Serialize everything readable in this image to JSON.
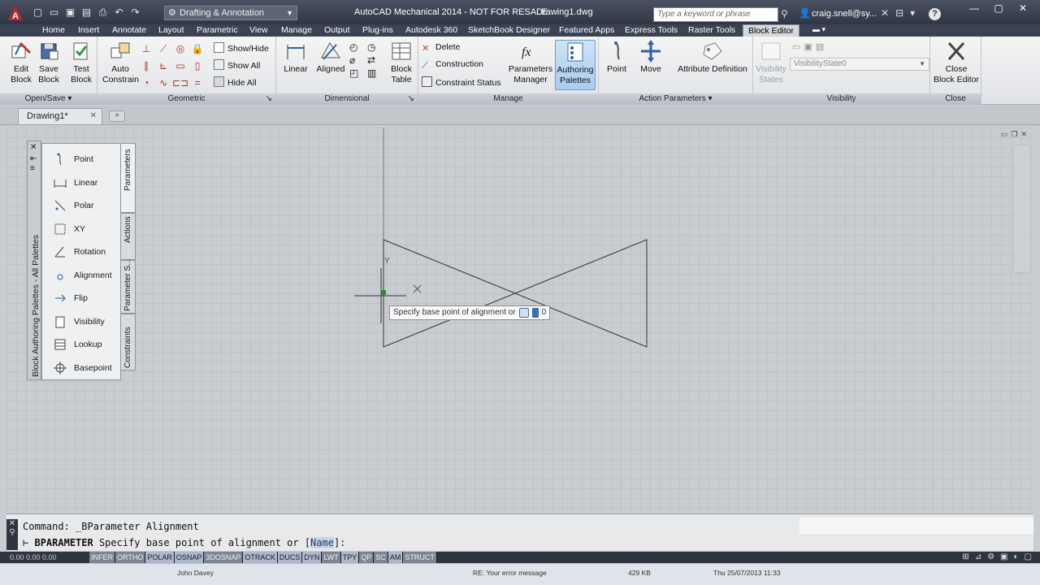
{
  "titlebar": {
    "workspace": "Drafting & Annotation",
    "app_title": "AutoCAD Mechanical 2014 - NOT FOR RESALE",
    "file_name": "Drawing1.dwg",
    "search_placeholder": "Type a keyword or phrase",
    "user": "craig.snell@sy..."
  },
  "tabs": [
    "Home",
    "Insert",
    "Annotate",
    "Layout",
    "Parametric",
    "View",
    "Manage",
    "Output",
    "Plug-ins",
    "Autodesk 360",
    "SketchBook Designer",
    "Featured Apps",
    "Express Tools",
    "Raster Tools",
    "Block Editor"
  ],
  "active_tab": "Block Editor",
  "ribbon": {
    "open_save": {
      "title": "Open/Save",
      "edit_block": "Edit\nBlock",
      "save_block": "Save\nBlock"
    },
    "geometric": {
      "title": "Geometric",
      "test_block": "Test\nBlock",
      "auto_constrain": "Auto\nConstrain",
      "show_hide": "Show/Hide",
      "show_all": "Show All",
      "hide_all": "Hide All"
    },
    "dimensional": {
      "title": "Dimensional",
      "linear": "Linear",
      "aligned": "Aligned",
      "block_table": "Block\nTable"
    },
    "manage": {
      "title": "Manage",
      "delete": "Delete",
      "construction": "Construction",
      "constraint_status": "Constraint Status",
      "parameters_manager": "Parameters\nManager",
      "authoring_palettes": "Authoring\nPalettes"
    },
    "action_parameters": {
      "title": "Action Parameters",
      "point": "Point",
      "move": "Move",
      "attribute_definition": "Attribute Definition"
    },
    "visibility": {
      "title": "Visibility",
      "visibility_states": "Visibility\nStates",
      "state": "VisibilityState0"
    },
    "close": {
      "title": "Close",
      "close_block_editor": "Close\nBlock Editor"
    }
  },
  "doc_tab": "Drawing1*",
  "palette": {
    "title": "Block Authoring Palettes - All Palettes",
    "items": [
      "Point",
      "Linear",
      "Polar",
      "XY",
      "Rotation",
      "Alignment",
      "Flip",
      "Visibility",
      "Lookup",
      "Basepoint"
    ],
    "tabs": [
      "Parameters",
      "Actions",
      "Parameter S...",
      "Constraints"
    ]
  },
  "tooltip": {
    "prompt": "Specify base point of alignment or",
    "value": "0"
  },
  "command": {
    "history": "Command: _BParameter Alignment",
    "current_cmd": "BPARAMETER",
    "current_prompt": "Specify base point of alignment or [",
    "current_option": "Name",
    "current_end": "]:"
  },
  "status": {
    "coords": "0.00  0.00  0.00",
    "toggles": [
      "INFER",
      "ORTHO",
      "POLAR",
      "OSNAP",
      "3DOSNAP",
      "OTRACK",
      "DUCS",
      "DYN",
      "LWT",
      "TPY",
      "QP",
      "SC",
      "AM",
      "STRUCT"
    ],
    "on": [
      "POLAR",
      "OSNAP",
      "OTRACK",
      "DUCS",
      "DYN",
      "TPY",
      "AM"
    ]
  },
  "taskbar": {
    "author": "John Davey",
    "subject": "RE: Your error message",
    "size": "429 KB",
    "date": "Thu 25/07/2013 11:33"
  }
}
